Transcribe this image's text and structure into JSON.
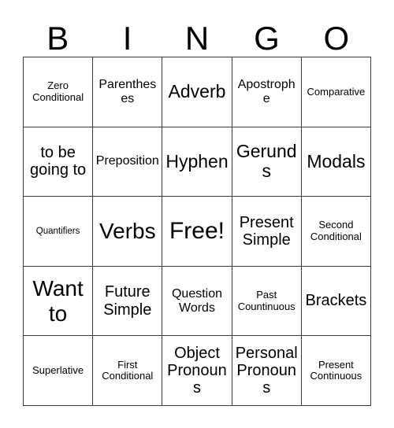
{
  "card": {
    "title": "BINGO",
    "header_letters": [
      "B",
      "I",
      "N",
      "G",
      "O"
    ],
    "columns": 5,
    "rows": 5,
    "colors": {
      "background": "#ffffff",
      "text": "#000000",
      "grid_line": "#3a3a3a"
    },
    "cells": [
      {
        "text": "Zero Conditional",
        "size": "fs-xs",
        "free": false
      },
      {
        "text": "Parentheses",
        "size": "fs-sm",
        "free": false
      },
      {
        "text": "Adverb",
        "size": "fs-lg",
        "free": false
      },
      {
        "text": "Apostrophe",
        "size": "fs-sm",
        "free": false
      },
      {
        "text": "Comparative",
        "size": "fs-xs",
        "free": false
      },
      {
        "text": "to be going to",
        "size": "fs-md",
        "free": false
      },
      {
        "text": "Preposition",
        "size": "fs-sm",
        "free": false
      },
      {
        "text": "Hyphen",
        "size": "fs-lg",
        "free": false
      },
      {
        "text": "Gerunds",
        "size": "fs-lg",
        "free": false
      },
      {
        "text": "Modals",
        "size": "fs-lg",
        "free": false
      },
      {
        "text": "Quantifiers",
        "size": "fs-xxs",
        "free": false
      },
      {
        "text": "Verbs",
        "size": "fs-xl",
        "free": false
      },
      {
        "text": "Free!",
        "size": "fs-xxl",
        "free": true
      },
      {
        "text": "Present Simple",
        "size": "fs-md",
        "free": false
      },
      {
        "text": "Second Conditional",
        "size": "fs-xs",
        "free": false
      },
      {
        "text": "Want to",
        "size": "fs-xl",
        "free": false
      },
      {
        "text": "Future Simple",
        "size": "fs-md",
        "free": false
      },
      {
        "text": "Question Words",
        "size": "fs-sm",
        "free": false
      },
      {
        "text": "Past Countinuous",
        "size": "fs-xs",
        "free": false
      },
      {
        "text": "Brackets",
        "size": "fs-md",
        "free": false
      },
      {
        "text": "Superlative",
        "size": "fs-xs",
        "free": false
      },
      {
        "text": "First Conditional",
        "size": "fs-xs",
        "free": false
      },
      {
        "text": "Object Pronouns",
        "size": "fs-md",
        "free": false
      },
      {
        "text": "Personal Pronouns",
        "size": "fs-md",
        "free": false
      },
      {
        "text": "Present Continuous",
        "size": "fs-xs",
        "free": false
      }
    ]
  }
}
